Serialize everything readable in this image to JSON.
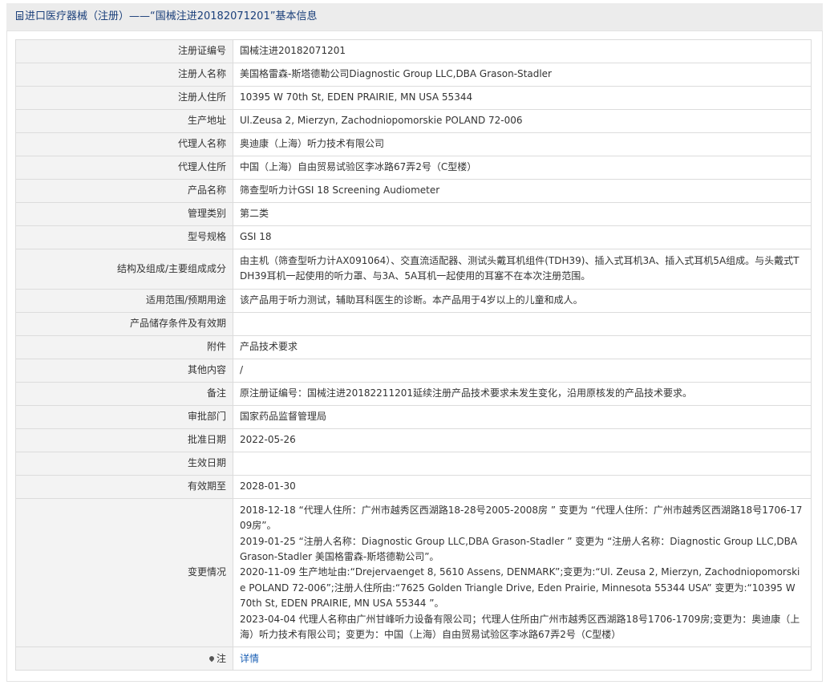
{
  "header": {
    "title": "进口医疗器械（注册）——“国械注进20182071201”基本信息"
  },
  "rows": [
    {
      "label": "注册证编号",
      "value": "国械注进20182071201"
    },
    {
      "label": "注册人名称",
      "value": "美国格雷森-斯塔德勒公司Diagnostic Group LLC,DBA Grason-Stadler"
    },
    {
      "label": "注册人住所",
      "value": "10395 W 70th St, EDEN PRAIRIE, MN USA 55344"
    },
    {
      "label": "生产地址",
      "value": "Ul.Zeusa 2, Mierzyn, Zachodniopomorskie POLAND 72-006"
    },
    {
      "label": "代理人名称",
      "value": "奥迪康（上海）听力技术有限公司"
    },
    {
      "label": "代理人住所",
      "value": "中国（上海）自由贸易试验区李冰路67弄2号（C型楼）"
    },
    {
      "label": "产品名称",
      "value": "筛查型听力计GSI 18 Screening Audiometer"
    },
    {
      "label": "管理类别",
      "value": "第二类"
    },
    {
      "label": "型号规格",
      "value": "GSI 18"
    },
    {
      "label": "结构及组成/主要组成成分",
      "value": "由主机（筛查型听力计AX091064）、交直流适配器、测试头戴耳机组件(TDH39)、插入式耳机3A、插入式耳机5A组成。与头戴式TDH39耳机一起使用的听力罩、与3A、5A耳机一起使用的耳塞不在本次注册范围。"
    },
    {
      "label": "适用范围/预期用途",
      "value": "该产品用于听力测试，辅助耳科医生的诊断。本产品用于4岁以上的儿童和成人。"
    },
    {
      "label": "产品储存条件及有效期",
      "value": ""
    },
    {
      "label": "附件",
      "value": "产品技术要求"
    },
    {
      "label": "其他内容",
      "value": "/"
    },
    {
      "label": "备注",
      "value": "原注册证编号：国械注进20182211201延续注册产品技术要求未发生变化，沿用原核发的产品技术要求。"
    },
    {
      "label": "审批部门",
      "value": "国家药品监督管理局"
    },
    {
      "label": "批准日期",
      "value": "2022-05-26"
    },
    {
      "label": "生效日期",
      "value": ""
    },
    {
      "label": "有效期至",
      "value": "2028-01-30"
    }
  ],
  "changes": {
    "label": "变更情况",
    "entries": [
      "2018-12-18 “代理人住所：广州市越秀区西湖路18-28号2005-2008房 ” 变更为 “代理人住所：广州市越秀区西湖路18号1706-1709房”。",
      "2019-01-25 “注册人名称：Diagnostic Group LLC,DBA Grason-Stadler ” 变更为 “注册人名称：Diagnostic Group LLC,DBA Grason-Stadler 美国格雷森-斯塔德勒公司”。",
      "2020-11-09 生产地址由:“Drejervaenget 8, 5610 Assens, DENMARK”;变更为:“Ul. Zeusa 2, Mierzyn, Zachodniopomorskie POLAND 72-006”;注册人住所由:“7625 Golden Triangle Drive, Eden Prairie, Minnesota 55344 USA” 变更为:“10395 W 70th St, EDEN PRAIRIE, MN USA 55344 ”。",
      "2023-04-04 代理人名称由广州甘峰听力设备有限公司；代理人住所由广州市越秀区西湖路18号1706-1709房;变更为：奥迪康（上海）听力技术有限公司；变更为：中国（上海）自由贸易试验区李冰路67弄2号（C型楼）"
    ]
  },
  "note": {
    "label": "注",
    "icon": "pin-icon",
    "link_text": "详情"
  },
  "colors": {
    "header_bg": "#ececec",
    "title_text": "#1a3f7a",
    "label_bg": "#f3f3f3",
    "link": "#1a5fb4",
    "border": "#dcdcdc"
  }
}
